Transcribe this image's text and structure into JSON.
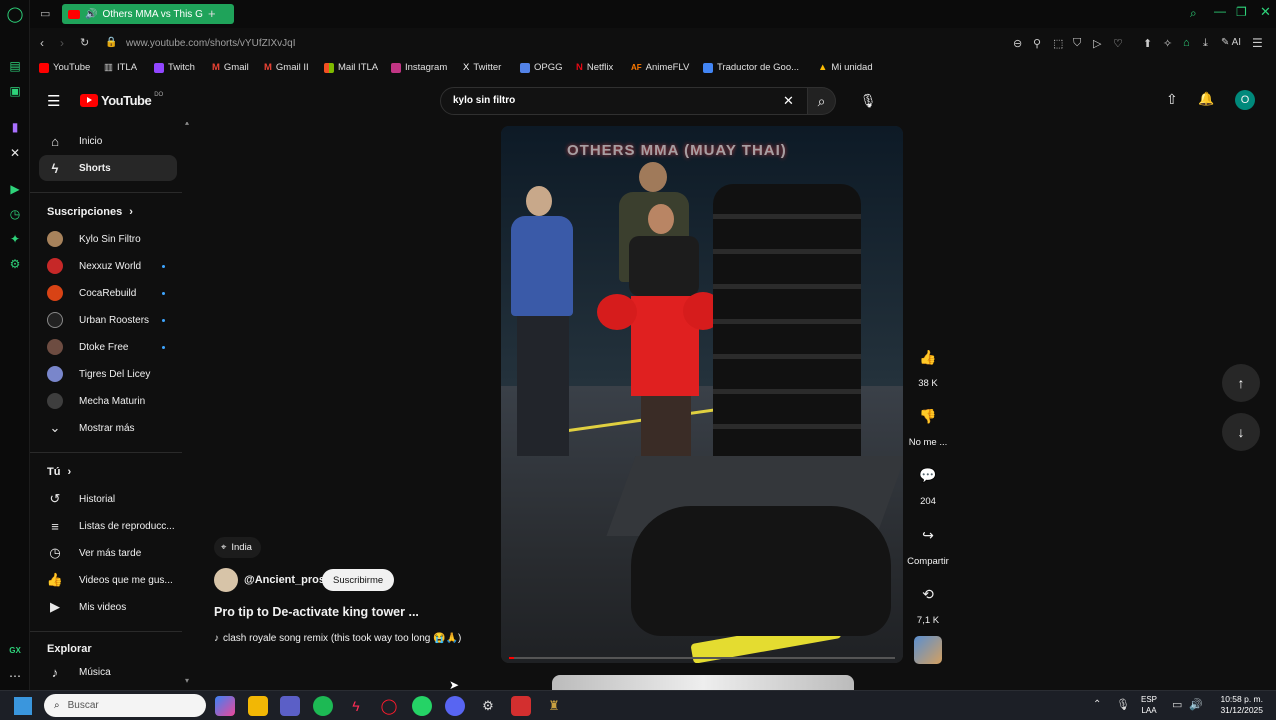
{
  "browser": {
    "tab_title": "Others MMA vs This G",
    "url": "www.youtube.com/shorts/vYUfZIXvJqI",
    "bookmarks": [
      "YouTube",
      "ITLA",
      "Twitch",
      "Gmail",
      "Gmail II",
      "Mail ITLA",
      "Instagram",
      "Twitter",
      "OPGG",
      "Netflix",
      "AnimeFLV",
      "Traductor de Goo...",
      "Mi unidad"
    ],
    "ai_label": "AI"
  },
  "youtube": {
    "logo_text": "YouTube",
    "country_code": "DO",
    "search_value": "kylo sin filtro",
    "account_initial": "O"
  },
  "sidebar": {
    "main": [
      "Inicio",
      "Shorts"
    ],
    "subscriptions_title": "Suscripciones",
    "subscriptions": [
      "Kylo Sin Filtro",
      "Nexxuz World",
      "CocaRebuild",
      "Urban Roosters",
      "Dtoke Free",
      "Tigres Del Licey",
      "Mecha Maturin"
    ],
    "show_more": "Mostrar más",
    "you_title": "Tú",
    "you_items": [
      "Historial",
      "Listas de reproducc...",
      "Ver más tarde",
      "Videos que me gus...",
      "Mis videos"
    ],
    "explore_title": "Explorar",
    "explore_items": [
      "Música"
    ]
  },
  "short": {
    "location": "India",
    "channel": "@Ancient_pros",
    "subscribe": "Suscribirme",
    "title": "Pro tip to De-activate king tower ...",
    "music": "clash royale song remix (this took way too long 😭🙏)",
    "overlay_text": "OTHERS MMA (MUAY THAI)",
    "likes": "38 K",
    "dislike_label": "No me ...",
    "comments": "204",
    "share_label": "Compartir",
    "remix": "7,1 K"
  },
  "taskbar": {
    "search_placeholder": "Buscar",
    "lang_top": "ESP",
    "lang_bottom": "LAA",
    "time": "10:58 p. m.",
    "date": "31/12/2025"
  }
}
